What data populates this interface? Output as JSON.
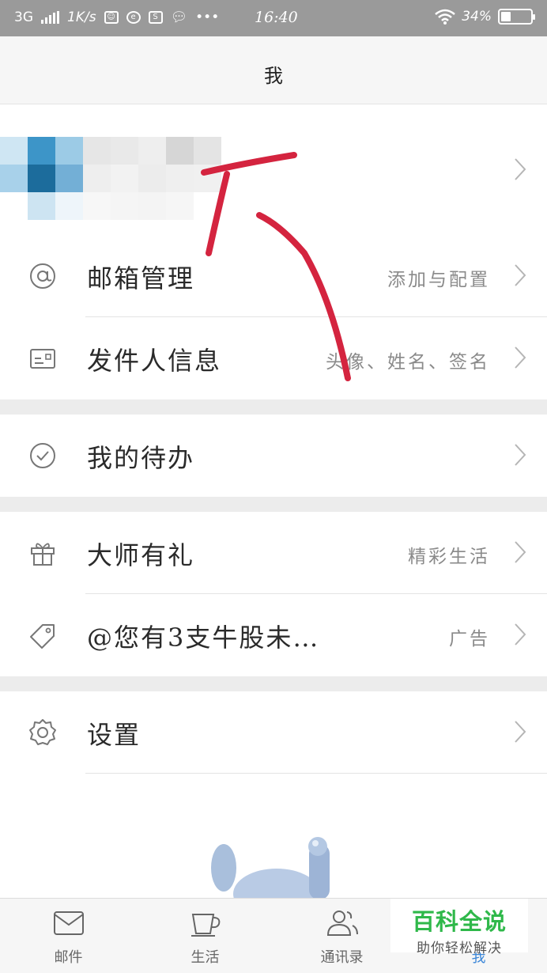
{
  "status_bar": {
    "network": "3G",
    "speed": "1K/s",
    "time": "16:40",
    "battery": "34%",
    "battery_level": 0.34
  },
  "header": {
    "title": "我"
  },
  "menu": {
    "mailbox_manage": {
      "label": "邮箱管理",
      "hint": "添加与配置",
      "icon": "at-icon"
    },
    "sender_info": {
      "label": "发件人信息",
      "hint": "头像、姓名、签名",
      "icon": "id-card-icon"
    },
    "todo": {
      "label": "我的待办",
      "icon": "check-circle-icon"
    },
    "master_gift": {
      "label": "大师有礼",
      "hint": "精彩生活",
      "icon": "gift-icon"
    },
    "ad": {
      "label": "@您有3支牛股未…",
      "hint": "广告",
      "icon": "tag-icon"
    },
    "settings": {
      "label": "设置",
      "icon": "gear-icon"
    }
  },
  "tabs": [
    {
      "label": "邮件",
      "icon": "mail-icon"
    },
    {
      "label": "生活",
      "icon": "cup-icon"
    },
    {
      "label": "通讯录",
      "icon": "contacts-icon"
    },
    {
      "label": "我",
      "icon": "person-icon"
    }
  ],
  "watermark": {
    "title": "百科全说",
    "subtitle": "助你轻松解决"
  },
  "colors": {
    "accent": "#3a86d8",
    "annotation": "#d4243f",
    "watermark": "#2fb84a"
  }
}
